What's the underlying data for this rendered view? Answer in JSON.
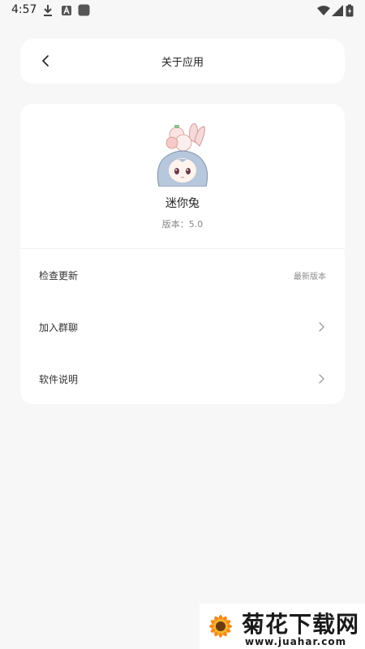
{
  "status_bar": {
    "time": "4:57",
    "icons_left": [
      "download-icon",
      "a-badge-icon",
      "square-app-icon"
    ],
    "icons_right": [
      "wifi-icon",
      "signal-icon",
      "battery-charging-icon"
    ]
  },
  "header": {
    "title": "关于应用",
    "back_icon": "chevron-left-icon"
  },
  "app_info": {
    "name": "迷你兔",
    "version_text": "版本：5.0"
  },
  "settings": [
    {
      "label": "检查更新",
      "value": "最新版本",
      "has_chevron": false
    },
    {
      "label": "加入群聊",
      "value": "",
      "has_chevron": true
    },
    {
      "label": "软件说明",
      "value": "",
      "has_chevron": true
    }
  ],
  "watermark": {
    "title": "菊花下载网",
    "url": "www.juahar.com"
  },
  "colors": {
    "background": "#f7f7f7",
    "card": "#ffffff",
    "text_primary": "#222222",
    "text_secondary": "#888888"
  }
}
